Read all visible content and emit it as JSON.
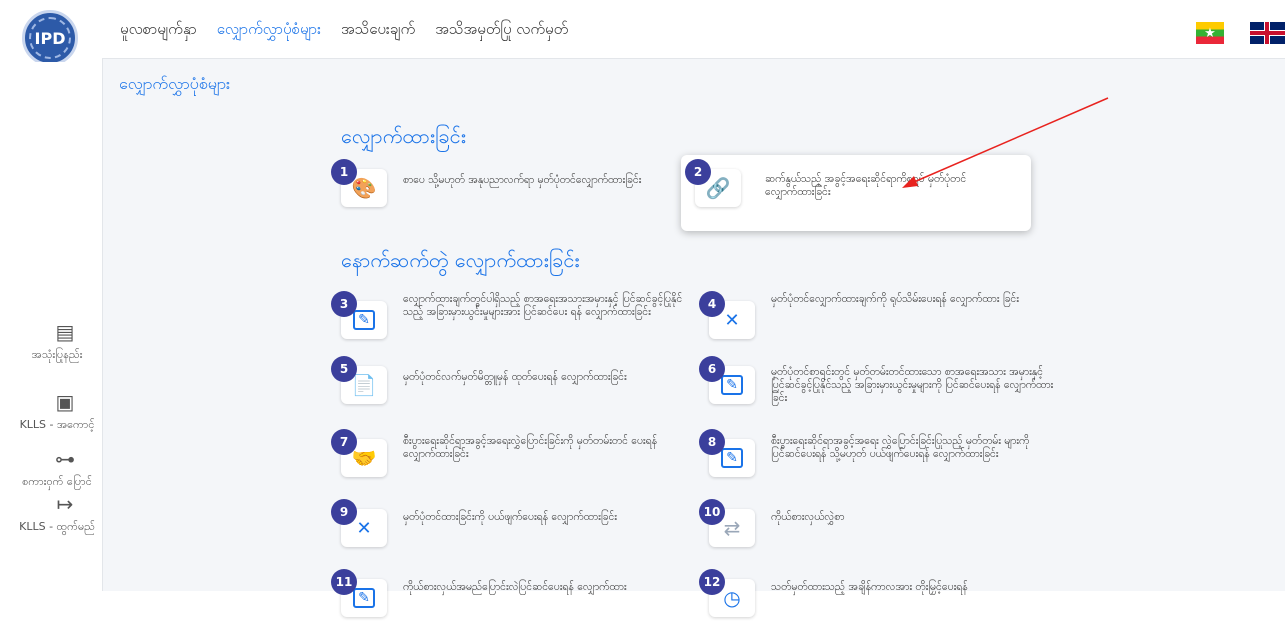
{
  "header": {
    "logo_text": "IPD",
    "nav": [
      {
        "label": "မူလစာမျက်နှာ",
        "active": false
      },
      {
        "label": "လျှောက်လွှာပုံစံများ",
        "active": true
      },
      {
        "label": "အသိပေးချက်",
        "active": false
      },
      {
        "label": "အသိအမှတ်ပြု လက်မှတ်",
        "active": false
      }
    ]
  },
  "sidebar": {
    "items": [
      {
        "icon": "book-icon",
        "label": "အသုံးပြုနည်း"
      },
      {
        "icon": "id-card-icon",
        "label": "KLLS - အကောင့်"
      },
      {
        "icon": "key-icon",
        "label": "စကားဝှက် ပြောင်"
      },
      {
        "icon": "logout-icon",
        "label": "KLLS - ထွက်မည်"
      }
    ]
  },
  "main": {
    "page_title": "လျှောက်လွှာပုံစံများ",
    "section_filing": "လျှောက်ထားခြင်း",
    "section_subsequent": "နောက်ဆက်တွဲ လျှောက်ထားခြင်း",
    "services": [
      {
        "num": "1",
        "icon": "palette-icon",
        "text": "စာပေ သို့မဟုတ် အနုပညာလက်ရာ မှတ်ပုံတင်လျှောက်ထားခြင်း"
      },
      {
        "num": "2",
        "icon": "link-icon",
        "text": "ဆက်နွယ်သည့် အခွင့်အရေးဆိုင်ရာကိစ္စရပ် မှတ်ပုံတင် လျှောက်ထားခြင်း"
      },
      {
        "num": "3",
        "icon": "edit-icon",
        "text": "လျှောက်ထားချက်တွင်ပါရှိသည့် စာအရေးအသားအမှားနှင့် ပြင်ဆင်ခွင့်ပြုနိုင်သည့် အခြားမှားယွင်းမှုများအား ပြင်ဆင်ပေး ရန် လျှောက်ထားခြင်း"
      },
      {
        "num": "4",
        "icon": "cancel-icon",
        "text": "မှတ်ပုံတင်လျှောက်ထားချက်ကို ရုပ်သိမ်းပေးရန် လျှောက်ထား ခြင်း"
      },
      {
        "num": "5",
        "icon": "document-icon",
        "text": "မှတ်ပုံတင်လက်မှတ်မိတ္တူမှန် ထုတ်ပေးရန် လျှောက်ထားခြင်း"
      },
      {
        "num": "6",
        "icon": "edit-icon",
        "text": "မှတ်ပုံတင်စာရင်းတွင် မှတ်တမ်းတင်ထားသော စာအရေးအသား အမှားနှင့် ပြင်ဆင်ခွင့်ပြုနိုင်သည့် အခြားမှားယွင်းမှုများကို ပြင်ဆင်ပေးရန် လျှောက်ထားခြင်း"
      },
      {
        "num": "7",
        "icon": "handshake-icon",
        "text": "စီးပွားရေးဆိုင်ရာအခွင့်အရေးလွှဲပြောင်းခြင်းကို မှတ်တမ်းတင် ပေးရန်လျှောက်ထားခြင်း"
      },
      {
        "num": "8",
        "icon": "edit-icon",
        "text": "စီးပွားရေးဆိုင်ရာအခွင့်အရေး လွှဲပြောင်းခြင်းပြုသည့် မှတ်တမ်း များကို ပြင်ဆင်ပေးရန် သို့မဟုတ် ပယ်ဖျက်ပေးရန် လျှောက်ထားခြင်း"
      },
      {
        "num": "9",
        "icon": "cancel-icon",
        "text": "မှတ်ပုံတင်ထားခြင်းကို ပယ်ဖျက်ပေးရန် လျှောက်ထားခြင်း"
      },
      {
        "num": "10",
        "icon": "representative-icon",
        "text": "ကိုယ်စားလှယ်လွှဲစာ"
      },
      {
        "num": "11",
        "icon": "edit-icon",
        "text": "ကိုယ်စားလှယ်အမည်ပြောင်းလဲပြင်ဆင်ပေးရန် လျှောက်ထား"
      },
      {
        "num": "12",
        "icon": "clock-icon",
        "text": "သတ်မှတ်ထားသည့် အချိန်ကာလအား တိုးမြှင့်ပေးရန်"
      }
    ]
  },
  "colors": {
    "accent": "#1a73e8",
    "badge": "#3b3f9c",
    "annotation_arrow": "#e8231f"
  }
}
